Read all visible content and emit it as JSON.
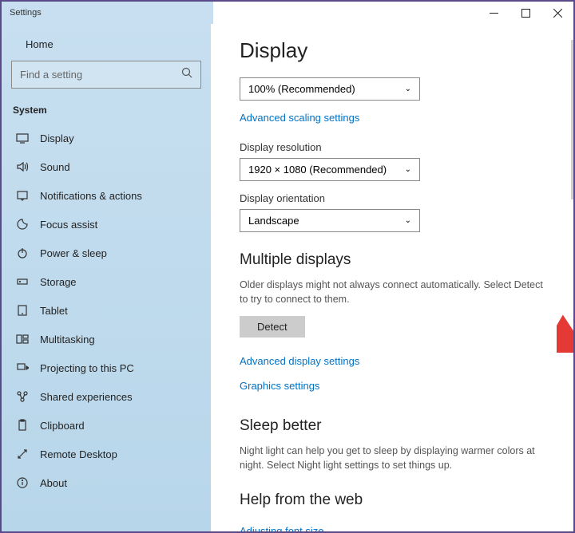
{
  "window": {
    "title": "Settings"
  },
  "sidebar": {
    "home": "Home",
    "search_placeholder": "Find a setting",
    "category": "System",
    "items": [
      {
        "label": "Display"
      },
      {
        "label": "Sound"
      },
      {
        "label": "Notifications & actions"
      },
      {
        "label": "Focus assist"
      },
      {
        "label": "Power & sleep"
      },
      {
        "label": "Storage"
      },
      {
        "label": "Tablet"
      },
      {
        "label": "Multitasking"
      },
      {
        "label": "Projecting to this PC"
      },
      {
        "label": "Shared experiences"
      },
      {
        "label": "Clipboard"
      },
      {
        "label": "Remote Desktop"
      },
      {
        "label": "About"
      }
    ]
  },
  "main": {
    "title": "Display",
    "scale": {
      "value": "100% (Recommended)"
    },
    "advanced_scaling": "Advanced scaling settings",
    "resolution_label": "Display resolution",
    "resolution": {
      "value": "1920 × 1080 (Recommended)"
    },
    "orientation_label": "Display orientation",
    "orientation": {
      "value": "Landscape"
    },
    "multi_heading": "Multiple displays",
    "multi_desc": "Older displays might not always connect automatically. Select Detect to try to connect to them.",
    "detect_btn": "Detect",
    "adv_display": "Advanced display settings",
    "graphics": "Graphics settings",
    "sleep_heading": "Sleep better",
    "sleep_desc": "Night light can help you get to sleep by displaying warmer colors at night. Select Night light settings to set things up.",
    "help_heading": "Help from the web",
    "help_link1": "Adjusting font size"
  }
}
